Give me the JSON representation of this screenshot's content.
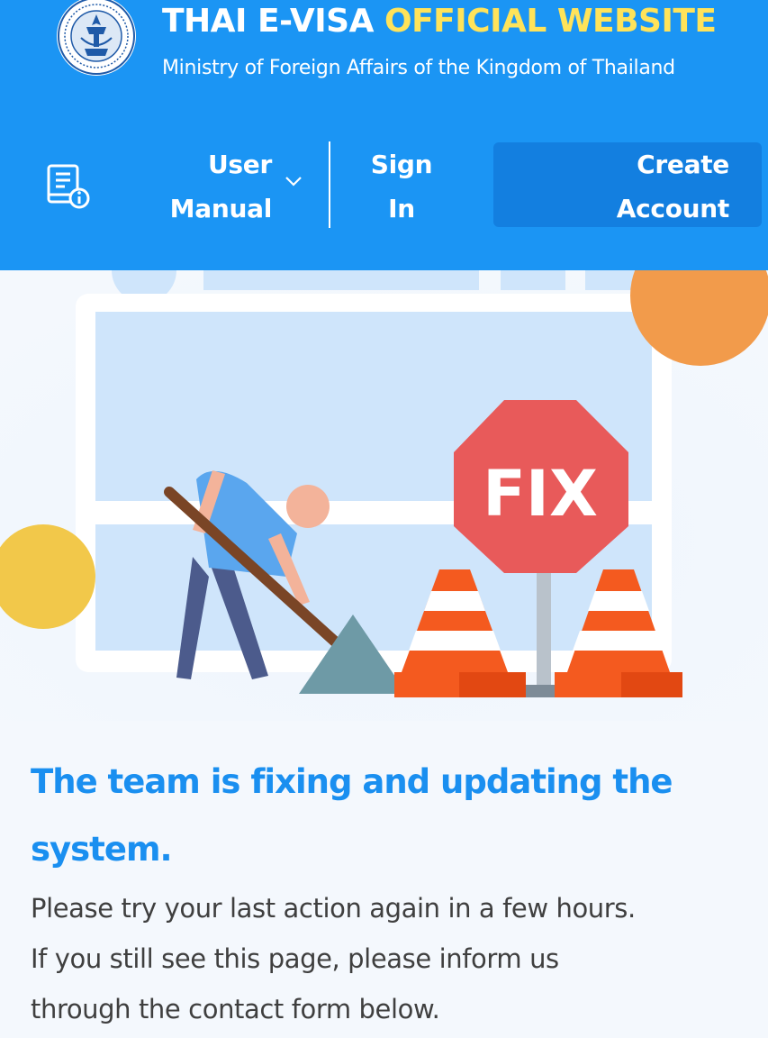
{
  "header": {
    "title_main": "THAI E-VISA",
    "title_accent": "OFFICIAL WEBSITE",
    "subtitle": "Ministry of Foreign Affairs of the Kingdom of Thailand",
    "emblem_icon": "thai-government-emblem-icon",
    "accent_color": "#ffe35a",
    "background_color": "#1b95f4"
  },
  "nav": {
    "manual_icon": "book-info-icon",
    "user_manual": [
      "User",
      "Manual"
    ],
    "dropdown_icon": "chevron-down-icon",
    "sign_in": [
      "Sign",
      "In"
    ],
    "create_account": [
      "Create",
      "Account"
    ]
  },
  "illustration": {
    "sign_text": "FIX"
  },
  "message": {
    "headline_lines": [
      "The team is fixing and updating the",
      "system."
    ],
    "body_lines": [
      "Please try your last action again in a few hours.",
      "If you still see this page, please inform us",
      "through the contact form below."
    ],
    "headline_color": "#1a8ff0"
  }
}
